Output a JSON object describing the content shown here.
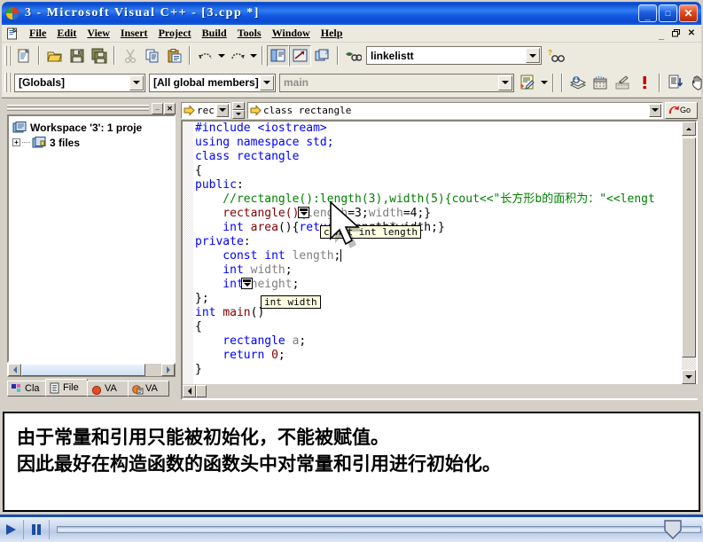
{
  "window": {
    "title": "3 - Microsoft Visual C++ - [3.cpp *]",
    "app_icon": "visual-cpp-icon",
    "buttons": {
      "minimize": "_",
      "maximize": "□",
      "close": "✕"
    }
  },
  "menubar": {
    "doc_icon": "document-icon",
    "items": [
      {
        "label": "File",
        "accel": "F"
      },
      {
        "label": "Edit",
        "accel": "E"
      },
      {
        "label": "View",
        "accel": "V"
      },
      {
        "label": "Insert",
        "accel": "I"
      },
      {
        "label": "Project",
        "accel": "P"
      },
      {
        "label": "Build",
        "accel": "B"
      },
      {
        "label": "Tools",
        "accel": "T"
      },
      {
        "label": "Window",
        "accel": "W"
      },
      {
        "label": "Help",
        "accel": "H"
      }
    ],
    "mdi_buttons": {
      "minimize": "_",
      "restore": "❐",
      "close": "✕"
    }
  },
  "toolbar_standard": {
    "buttons": [
      "new-document-icon",
      "open-folder-icon",
      "save-icon",
      "save-all-icon",
      "cut-icon",
      "copy-icon",
      "paste-icon",
      "undo-icon",
      "undo-dropdown-icon",
      "redo-icon",
      "redo-dropdown-icon",
      "workspace-window-icon",
      "output-window-icon",
      "window-list-icon",
      "find-in-files-icon",
      "find-binoculars-icon"
    ],
    "find_combo": {
      "value": "linkelistt",
      "placeholder": ""
    }
  },
  "toolbar_wizardbar": {
    "globals_combo": {
      "value": "[Globals]"
    },
    "members_combo": {
      "value": "[All global members]"
    },
    "function_combo": {
      "value": "main",
      "disabled": true
    },
    "action_icon": "wizardbar-action-icon",
    "buttons": [
      "compile-icon",
      "build-icon",
      "stop-build-icon",
      "breakpoint-icon",
      "go-icon",
      "hand-icon"
    ]
  },
  "workspace": {
    "titlebar_close": "✕",
    "titlebar_minimize": "_",
    "tree": [
      {
        "icon": "workspace-icon",
        "label": "Workspace '3': 1 proje",
        "expander": ""
      },
      {
        "icon": "project-icon",
        "label": "3 files",
        "expander": "+"
      }
    ],
    "tabs": [
      {
        "label": "Cla",
        "icon": "classview-icon",
        "active": false
      },
      {
        "label": "File",
        "icon": "fileview-icon",
        "active": true
      },
      {
        "label": "VA",
        "icon": "va-tomato-icon",
        "active": false
      },
      {
        "label": "VA",
        "icon": "va-outline-icon",
        "active": false
      }
    ]
  },
  "editor": {
    "scope_combo": {
      "value": "rec"
    },
    "member_combo": {
      "value": "class rectangle",
      "icon": "yellow-arrow-icon"
    },
    "go_button": {
      "label": "Go",
      "icon": "go-arrow-icon"
    },
    "code_lines": [
      [
        {
          "t": "#include ",
          "c": "kw"
        },
        {
          "t": "<iostream>",
          "c": "kw"
        }
      ],
      [
        {
          "t": "using namespace std;",
          "c": "kw"
        }
      ],
      [
        {
          "t": "class rectangle",
          "c": "kw"
        }
      ],
      [
        {
          "t": "{",
          "c": "pl"
        }
      ],
      [
        {
          "t": "public",
          "c": "kw"
        },
        {
          "t": ":",
          "c": "pl"
        }
      ],
      [
        {
          "t": "    //rectangle():length(3),width(5){cout<<\"长方形b的面积为：\"<<lengt",
          "c": "cmt"
        }
      ],
      [
        {
          "t": "    rectangle(){",
          "c": "cls"
        },
        {
          "t": "length",
          "c": "gray"
        },
        {
          "t": "=3;",
          "c": "pl"
        },
        {
          "t": "width",
          "c": "gray"
        },
        {
          "t": "=4;}",
          "c": "pl"
        }
      ],
      [
        {
          "t": "    int ",
          "c": "kw"
        },
        {
          "t": "area",
          "c": "cls"
        },
        {
          "t": "(){",
          "c": "pl"
        },
        {
          "t": "return",
          "c": "kw"
        },
        {
          "t": " length*width;}",
          "c": "pl"
        }
      ],
      [
        {
          "t": "private",
          "c": "kw"
        },
        {
          "t": ":",
          "c": "pl"
        }
      ],
      [
        {
          "t": "    const int ",
          "c": "kw"
        },
        {
          "t": "length",
          "c": "gray"
        },
        {
          "t": ";",
          "c": "pl"
        }
      ],
      [
        {
          "t": "    int ",
          "c": "kw"
        },
        {
          "t": "width",
          "c": "gray"
        },
        {
          "t": ";",
          "c": "pl"
        }
      ],
      [
        {
          "t": "    int ",
          "c": "kw"
        },
        {
          "t": "height",
          "c": "gray"
        },
        {
          "t": ";",
          "c": "pl"
        }
      ],
      [
        {
          "t": "};",
          "c": "pl"
        }
      ],
      [
        {
          "t": "int ",
          "c": "kw"
        },
        {
          "t": "main",
          "c": "cls"
        },
        {
          "t": "()",
          "c": "pl"
        }
      ],
      [
        {
          "t": "{",
          "c": "pl"
        }
      ],
      [
        {
          "t": "    rectangle ",
          "c": "kw"
        },
        {
          "t": "a",
          "c": "gray"
        },
        {
          "t": ";",
          "c": "pl"
        }
      ],
      [
        {
          "t": "    return ",
          "c": "kw"
        },
        {
          "t": "0",
          "c": "cls"
        },
        {
          "t": ";",
          "c": "pl"
        }
      ],
      [
        {
          "t": "}",
          "c": "pl"
        }
      ]
    ],
    "tooltips": [
      {
        "text": "const int length",
        "name": "quickinfo-tooltip-length"
      },
      {
        "text": "int width",
        "name": "quickinfo-tooltip-width"
      }
    ]
  },
  "subtitle": {
    "line1": "由于常量和引用只能被初始化，不能被赋值。",
    "line2": "因此最好在构造函数的函数头中对常量和引用进行初始化。"
  },
  "mediabar": {
    "play_icon": "play-icon",
    "pause_icon": "pause-icon",
    "seek_thumb": "seek-thumb-icon",
    "progress_percent": 100
  },
  "colors": {
    "keyword": "#0000ff",
    "comment": "#008000",
    "classname": "#800000",
    "identifier": "#808080",
    "titlebar": "#0a48c8",
    "face": "#d4d0c8",
    "tooltip_bg": "#ffffe1"
  }
}
